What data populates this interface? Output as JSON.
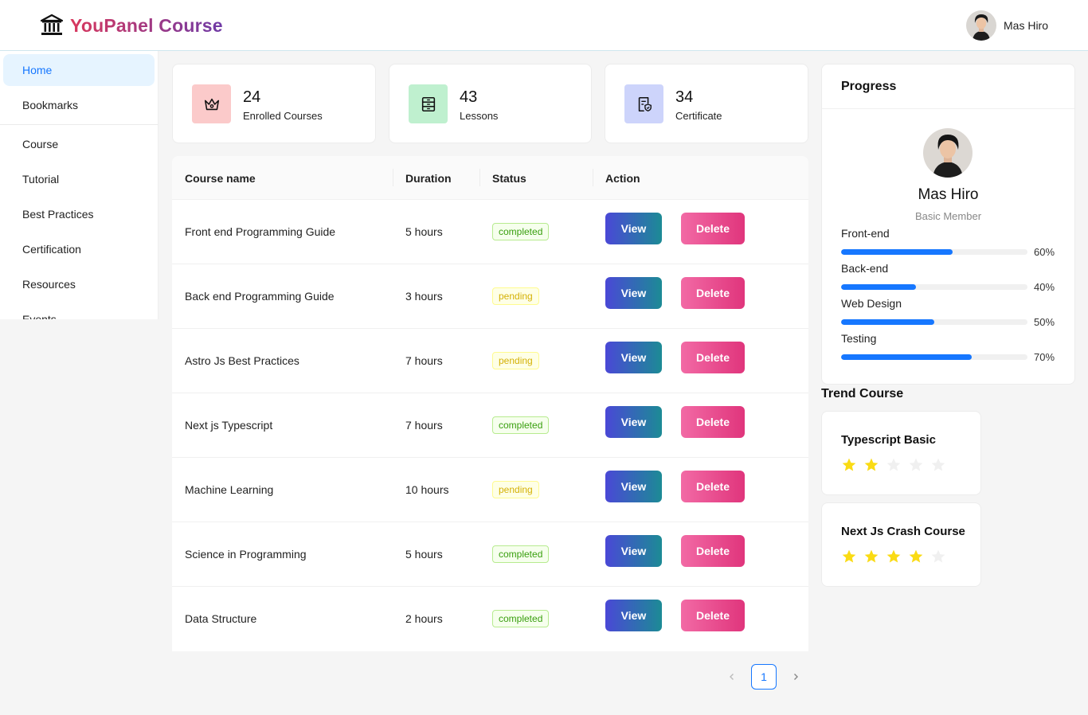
{
  "brand": {
    "title": "YouPanel Course"
  },
  "header": {
    "user_name": "Mas Hiro"
  },
  "sidebar": {
    "items": [
      {
        "label": "Home",
        "active": true
      },
      {
        "label": "Bookmarks"
      },
      {
        "label": "Course"
      },
      {
        "label": "Tutorial"
      },
      {
        "label": "Best Practices"
      },
      {
        "label": "Certification"
      },
      {
        "label": "Resources"
      },
      {
        "label": "Events"
      }
    ]
  },
  "stats": [
    {
      "value": "24",
      "label": "Enrolled Courses",
      "icon": "crown-icon",
      "color": "#fbcaca"
    },
    {
      "value": "43",
      "label": "Lessons",
      "icon": "archive-icon",
      "color": "#bff0cf"
    },
    {
      "value": "34",
      "label": "Certificate",
      "icon": "certificate-icon",
      "color": "#cdd4fb"
    }
  ],
  "table": {
    "headers": [
      "Course name",
      "Duration",
      "Status",
      "Action"
    ],
    "view_label": "View",
    "delete_label": "Delete",
    "rows": [
      {
        "name": "Front end Programming Guide",
        "duration": "5 hours",
        "status": "completed"
      },
      {
        "name": "Back end Programming Guide",
        "duration": "3 hours",
        "status": "pending"
      },
      {
        "name": "Astro Js Best Practices",
        "duration": "7 hours",
        "status": "pending"
      },
      {
        "name": "Next js Typescript",
        "duration": "7 hours",
        "status": "completed"
      },
      {
        "name": "Machine Learning",
        "duration": "10 hours",
        "status": "pending"
      },
      {
        "name": "Science in Programming",
        "duration": "5 hours",
        "status": "completed"
      },
      {
        "name": "Data Structure",
        "duration": "2 hours",
        "status": "completed"
      }
    ]
  },
  "pagination": {
    "current": "1",
    "prev_icon": "chevron-left-icon",
    "next_icon": "chevron-right-icon"
  },
  "progress": {
    "title": "Progress",
    "name": "Mas Hiro",
    "role": "Basic Member",
    "skills": [
      {
        "label": "Front-end",
        "percent": 60,
        "percent_label": "60%"
      },
      {
        "label": "Back-end",
        "percent": 40,
        "percent_label": "40%"
      },
      {
        "label": "Web Design",
        "percent": 50,
        "percent_label": "50%"
      },
      {
        "label": "Testing",
        "percent": 70,
        "percent_label": "70%"
      }
    ]
  },
  "trend": {
    "title": "Trend Course",
    "courses": [
      {
        "name": "Typescript Basic",
        "rating": 2,
        "max": 5
      },
      {
        "name": "Next Js Crash Course",
        "rating": 4,
        "max": 5
      }
    ]
  },
  "colors": {
    "accent": "#1677ff",
    "star": "#fadb14",
    "star_empty": "#f0f0f0"
  }
}
